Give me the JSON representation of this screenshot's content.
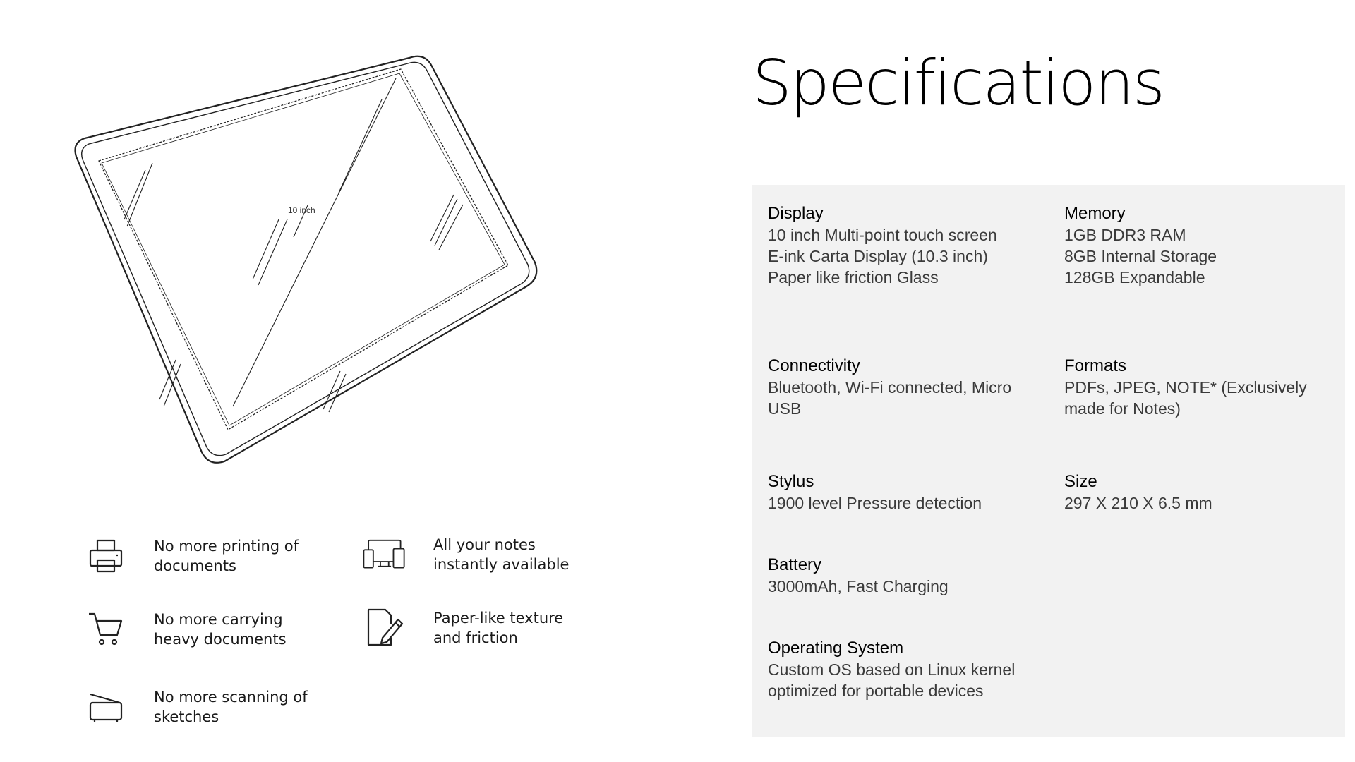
{
  "device": {
    "size_label": "10 inch"
  },
  "features": [
    {
      "icon": "printer-icon",
      "text": "No more printing of documents"
    },
    {
      "icon": "devices-icon",
      "text": "All your notes instantly available"
    },
    {
      "icon": "cart-icon",
      "text": "No more carrying heavy documents"
    },
    {
      "icon": "pen-document-icon",
      "text": "Paper-like texture and friction"
    },
    {
      "icon": "scanner-icon",
      "text": "No more scanning of sketches"
    }
  ],
  "title": "Specifications",
  "specs": {
    "display": {
      "label": "Display",
      "lines": [
        "10 inch Multi-point touch screen",
        "E-ink Carta Display (10.3 inch)",
        "Paper like friction Glass"
      ]
    },
    "memory": {
      "label": "Memory",
      "lines": [
        "1GB DDR3 RAM",
        "8GB Internal Storage",
        "128GB Expandable"
      ]
    },
    "connectivity": {
      "label": "Connectivity",
      "lines": [
        "Bluetooth, Wi-Fi connected, Micro",
        "USB"
      ]
    },
    "formats": {
      "label": "Formats",
      "lines": [
        "PDFs, JPEG, NOTE* (Exclusively",
        "made for Notes)"
      ]
    },
    "stylus": {
      "label": "Stylus",
      "lines": [
        "1900 level Pressure detection"
      ]
    },
    "size": {
      "label": "Size",
      "lines": [
        "297 X 210 X 6.5 mm"
      ]
    },
    "battery": {
      "label": "Battery",
      "lines": [
        "3000mAh, Fast Charging"
      ]
    },
    "os": {
      "label": "Operating System",
      "lines": [
        "Custom OS based on Linux kernel",
        "optimized for portable devices"
      ]
    }
  },
  "colors": {
    "panel": "#f2f2f2",
    "text": "#000000",
    "muted": "#3a3a3a",
    "line_art": "#222222"
  }
}
